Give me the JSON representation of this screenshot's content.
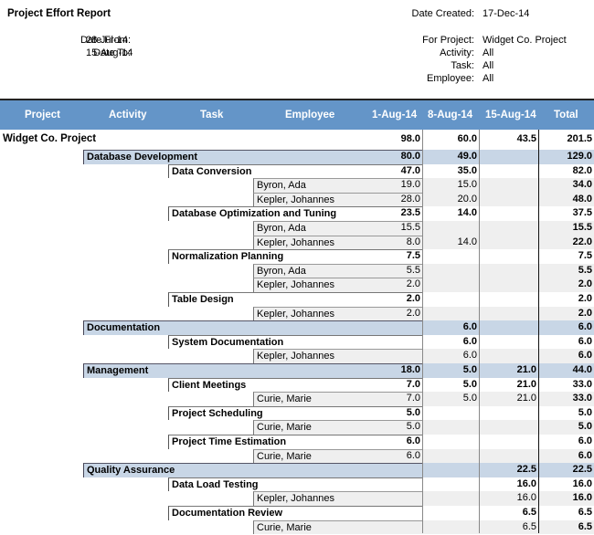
{
  "report": {
    "title": "Project Effort Report",
    "date_from_label": "Date From:",
    "date_from": "28-Jul-14",
    "date_to_label": "Date To:",
    "date_to": "15-Aug-14",
    "date_created_label": "Date Created:",
    "date_created": "17-Dec-14",
    "for_project_label": "For Project:",
    "for_project": "Widget Co. Project",
    "activity_label": "Activity:",
    "activity": "All",
    "task_label": "Task:",
    "task": "All",
    "employee_label": "Employee:",
    "employee": "All"
  },
  "columns": [
    "Project",
    "Activity",
    "Task",
    "Employee",
    "1-Aug-14",
    "8-Aug-14",
    "15-Aug-14",
    "Total"
  ],
  "rows": [
    {
      "level": "proj",
      "label": "Widget Co. Project",
      "values": [
        "98.0",
        "60.0",
        "43.5",
        "201.5"
      ]
    },
    {
      "level": "act",
      "label": "Database Development",
      "values": [
        "80.0",
        "49.0",
        "",
        "129.0"
      ]
    },
    {
      "level": "task",
      "label": "Data Conversion",
      "values": [
        "47.0",
        "35.0",
        "",
        "82.0"
      ]
    },
    {
      "level": "emp",
      "label": "Byron, Ada",
      "values": [
        "19.0",
        "15.0",
        "",
        "34.0"
      ]
    },
    {
      "level": "emp",
      "label": "Kepler, Johannes",
      "values": [
        "28.0",
        "20.0",
        "",
        "48.0"
      ]
    },
    {
      "level": "task",
      "label": "Database Optimization and Tuning",
      "values": [
        "23.5",
        "14.0",
        "",
        "37.5"
      ]
    },
    {
      "level": "emp",
      "label": "Byron, Ada",
      "values": [
        "15.5",
        "",
        "",
        "15.5"
      ]
    },
    {
      "level": "emp",
      "label": "Kepler, Johannes",
      "values": [
        "8.0",
        "14.0",
        "",
        "22.0"
      ]
    },
    {
      "level": "task",
      "label": "Normalization Planning",
      "values": [
        "7.5",
        "",
        "",
        "7.5"
      ]
    },
    {
      "level": "emp",
      "label": "Byron, Ada",
      "values": [
        "5.5",
        "",
        "",
        "5.5"
      ]
    },
    {
      "level": "emp",
      "label": "Kepler, Johannes",
      "values": [
        "2.0",
        "",
        "",
        "2.0"
      ]
    },
    {
      "level": "task",
      "label": "Table Design",
      "values": [
        "2.0",
        "",
        "",
        "2.0"
      ]
    },
    {
      "level": "emp",
      "label": "Kepler, Johannes",
      "values": [
        "2.0",
        "",
        "",
        "2.0"
      ]
    },
    {
      "level": "act",
      "label": "Documentation",
      "values": [
        "",
        "6.0",
        "",
        "6.0"
      ]
    },
    {
      "level": "task",
      "label": "System Documentation",
      "values": [
        "",
        "6.0",
        "",
        "6.0"
      ]
    },
    {
      "level": "emp",
      "label": "Kepler, Johannes",
      "values": [
        "",
        "6.0",
        "",
        "6.0"
      ]
    },
    {
      "level": "act",
      "label": "Management",
      "values": [
        "18.0",
        "5.0",
        "21.0",
        "44.0"
      ]
    },
    {
      "level": "task",
      "label": "Client Meetings",
      "values": [
        "7.0",
        "5.0",
        "21.0",
        "33.0"
      ]
    },
    {
      "level": "emp",
      "label": "Curie, Marie",
      "values": [
        "7.0",
        "5.0",
        "21.0",
        "33.0"
      ]
    },
    {
      "level": "task",
      "label": "Project Scheduling",
      "values": [
        "5.0",
        "",
        "",
        "5.0"
      ]
    },
    {
      "level": "emp",
      "label": "Curie, Marie",
      "values": [
        "5.0",
        "",
        "",
        "5.0"
      ]
    },
    {
      "level": "task",
      "label": "Project Time Estimation",
      "values": [
        "6.0",
        "",
        "",
        "6.0"
      ]
    },
    {
      "level": "emp",
      "label": "Curie, Marie",
      "values": [
        "6.0",
        "",
        "",
        "6.0"
      ]
    },
    {
      "level": "act",
      "label": "Quality Assurance",
      "values": [
        "",
        "",
        "22.5",
        "22.5"
      ]
    },
    {
      "level": "task",
      "label": "Data Load Testing",
      "values": [
        "",
        "",
        "16.0",
        "16.0"
      ]
    },
    {
      "level": "emp",
      "label": "Kepler, Johannes",
      "values": [
        "",
        "",
        "16.0",
        "16.0"
      ]
    },
    {
      "level": "task",
      "label": "Documentation Review",
      "values": [
        "",
        "",
        "6.5",
        "6.5"
      ]
    },
    {
      "level": "emp",
      "label": "Curie, Marie",
      "values": [
        "",
        "",
        "6.5",
        "6.5"
      ]
    }
  ]
}
